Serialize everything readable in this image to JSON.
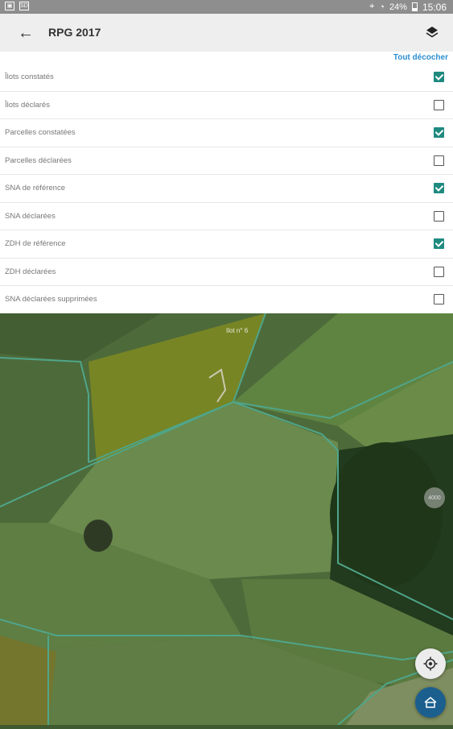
{
  "status_bar": {
    "battery": "24%",
    "time": "15:06"
  },
  "toolbar": {
    "title": "RPG 2017"
  },
  "panel": {
    "uncheck_all_label": "Tout décocher",
    "layers": [
      {
        "label": "Îlots constatés",
        "checked": true
      },
      {
        "label": "Îlots déclarés",
        "checked": false
      },
      {
        "label": "Parcelles constatées",
        "checked": true
      },
      {
        "label": "Parcelles déclarées",
        "checked": false
      },
      {
        "label": "SNA de référence",
        "checked": true
      },
      {
        "label": "SNA déclarées",
        "checked": false
      },
      {
        "label": "ZDH de référence",
        "checked": true
      },
      {
        "label": "ZDH déclarées",
        "checked": false
      },
      {
        "label": "SNA déclarées supprimées",
        "checked": false
      }
    ]
  },
  "map": {
    "ilot_label": "Ilot n° 6",
    "zoom_chip": "4000"
  },
  "colors": {
    "accent": "#1e8a80",
    "link": "#2b8fd0",
    "fab": "#1b5f8f"
  }
}
